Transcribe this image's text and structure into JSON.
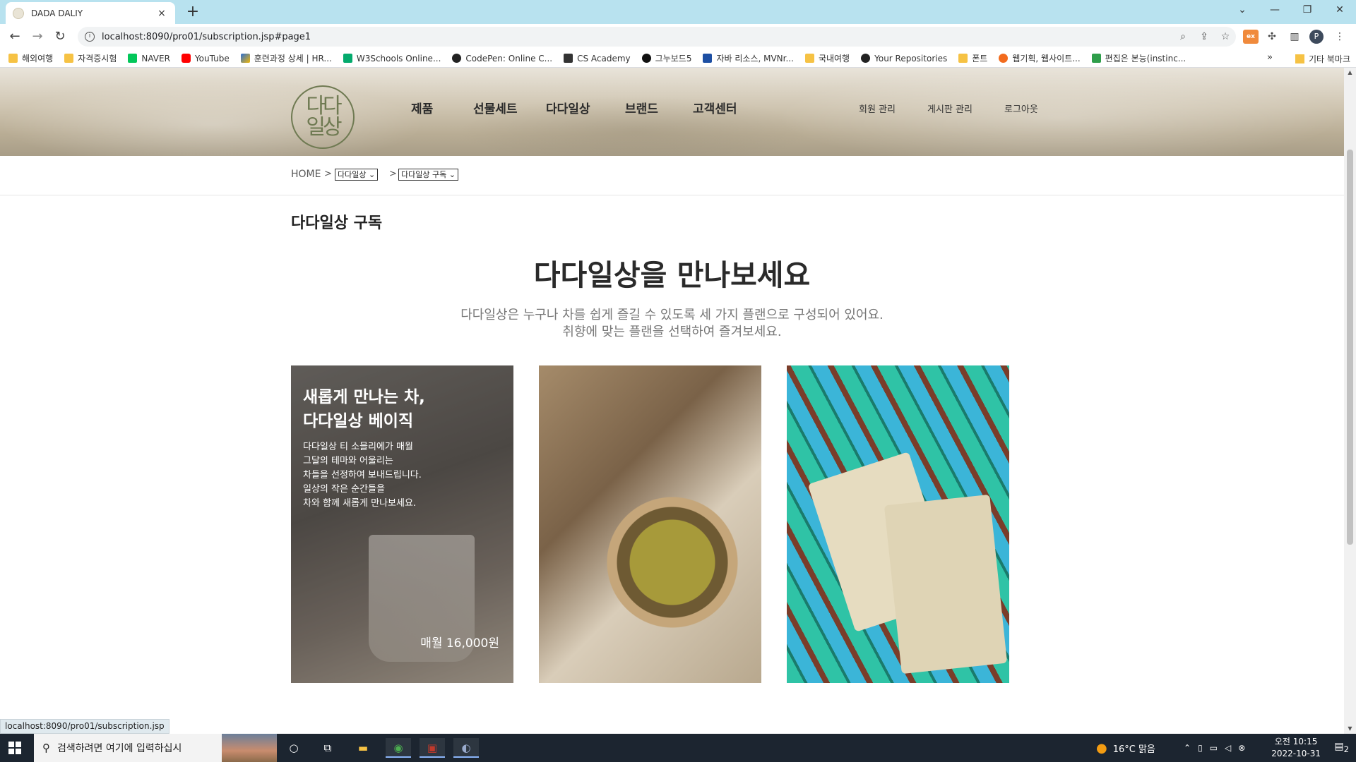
{
  "browser": {
    "tab_title": "DADA DALIY",
    "tab_close": "×",
    "new_tab": "+",
    "url": "localhost:8090/pro01/subscription.jsp#page1",
    "status_url": "localhost:8090/pro01/subscription.jsp",
    "bookmarks": [
      {
        "label": "해외여행",
        "icon": "folder-icon"
      },
      {
        "label": "자격증시험",
        "icon": "folder-icon"
      },
      {
        "label": "NAVER",
        "icon": "naver-icon"
      },
      {
        "label": "YouTube",
        "icon": "youtube-icon"
      },
      {
        "label": "훈련과정 상세 | HR...",
        "icon": "hrd-icon"
      },
      {
        "label": "W3Schools Online...",
        "icon": "w3schools-icon"
      },
      {
        "label": "CodePen: Online C...",
        "icon": "codepen-icon"
      },
      {
        "label": "CS Academy",
        "icon": "cs-academy-icon"
      },
      {
        "label": "그누보드5",
        "icon": "gnuboard-icon"
      },
      {
        "label": "자바 리소스, MVNr...",
        "icon": "mvn-icon"
      },
      {
        "label": "국내여행",
        "icon": "folder-icon"
      },
      {
        "label": "Your Repositories",
        "icon": "github-icon"
      },
      {
        "label": "폰트",
        "icon": "folder-icon"
      },
      {
        "label": "웹기획, 웹사이트...",
        "icon": "opera-icon"
      },
      {
        "label": "편집은 본능(instinc...",
        "icon": "green-check-icon"
      }
    ],
    "bookmarks_more": "»",
    "other_bookmarks": "기타 북마크"
  },
  "site": {
    "logo_text": "다다\n일상",
    "gnb": [
      "제품",
      "선물세트",
      "다다일상",
      "브랜드",
      "고객센터"
    ],
    "util": [
      "회원 관리",
      "게시판 관리",
      "로그아웃"
    ],
    "breadcrumb": {
      "home": "HOME",
      "sep": ">",
      "select1": "다다일상",
      "select2": "다다일상 구독"
    },
    "page_title": "다다일상 구독",
    "main_heading": "다다일상을 만나보세요",
    "sub_line1": "다다일상은 누구나 차를 쉽게 즐길 수 있도록 세 가지 플랜으로 구성되어 있어요.",
    "sub_line2": "취향에 맞는 플랜을 선택하여 즐겨보세요.",
    "cards": [
      {
        "heading": "새롭게 만나는 차,\n다다일상 베이직",
        "desc": "다다일상 티 소믈리에가 매월\n그달의 테마와 어울리는\n차들을 선정하여 보내드립니다.\n일상의 작은 순간들을\n차와 함께 새롭게 만나보세요.",
        "price": "매월 16,000원"
      },
      {
        "image": "green-tea-cup-photo"
      },
      {
        "image": "tea-bags-box-photo"
      }
    ]
  },
  "taskbar": {
    "search_placeholder": "검색하려면 여기에 입력하십시",
    "weather": "16°C  맑음",
    "time": "오전 10:15",
    "date": "2022-10-31",
    "notifications": "2"
  },
  "colors": {
    "tab_strip": "#b8e2ef",
    "logo_green": "#6f7a52",
    "taskbar": "#1c2530"
  }
}
